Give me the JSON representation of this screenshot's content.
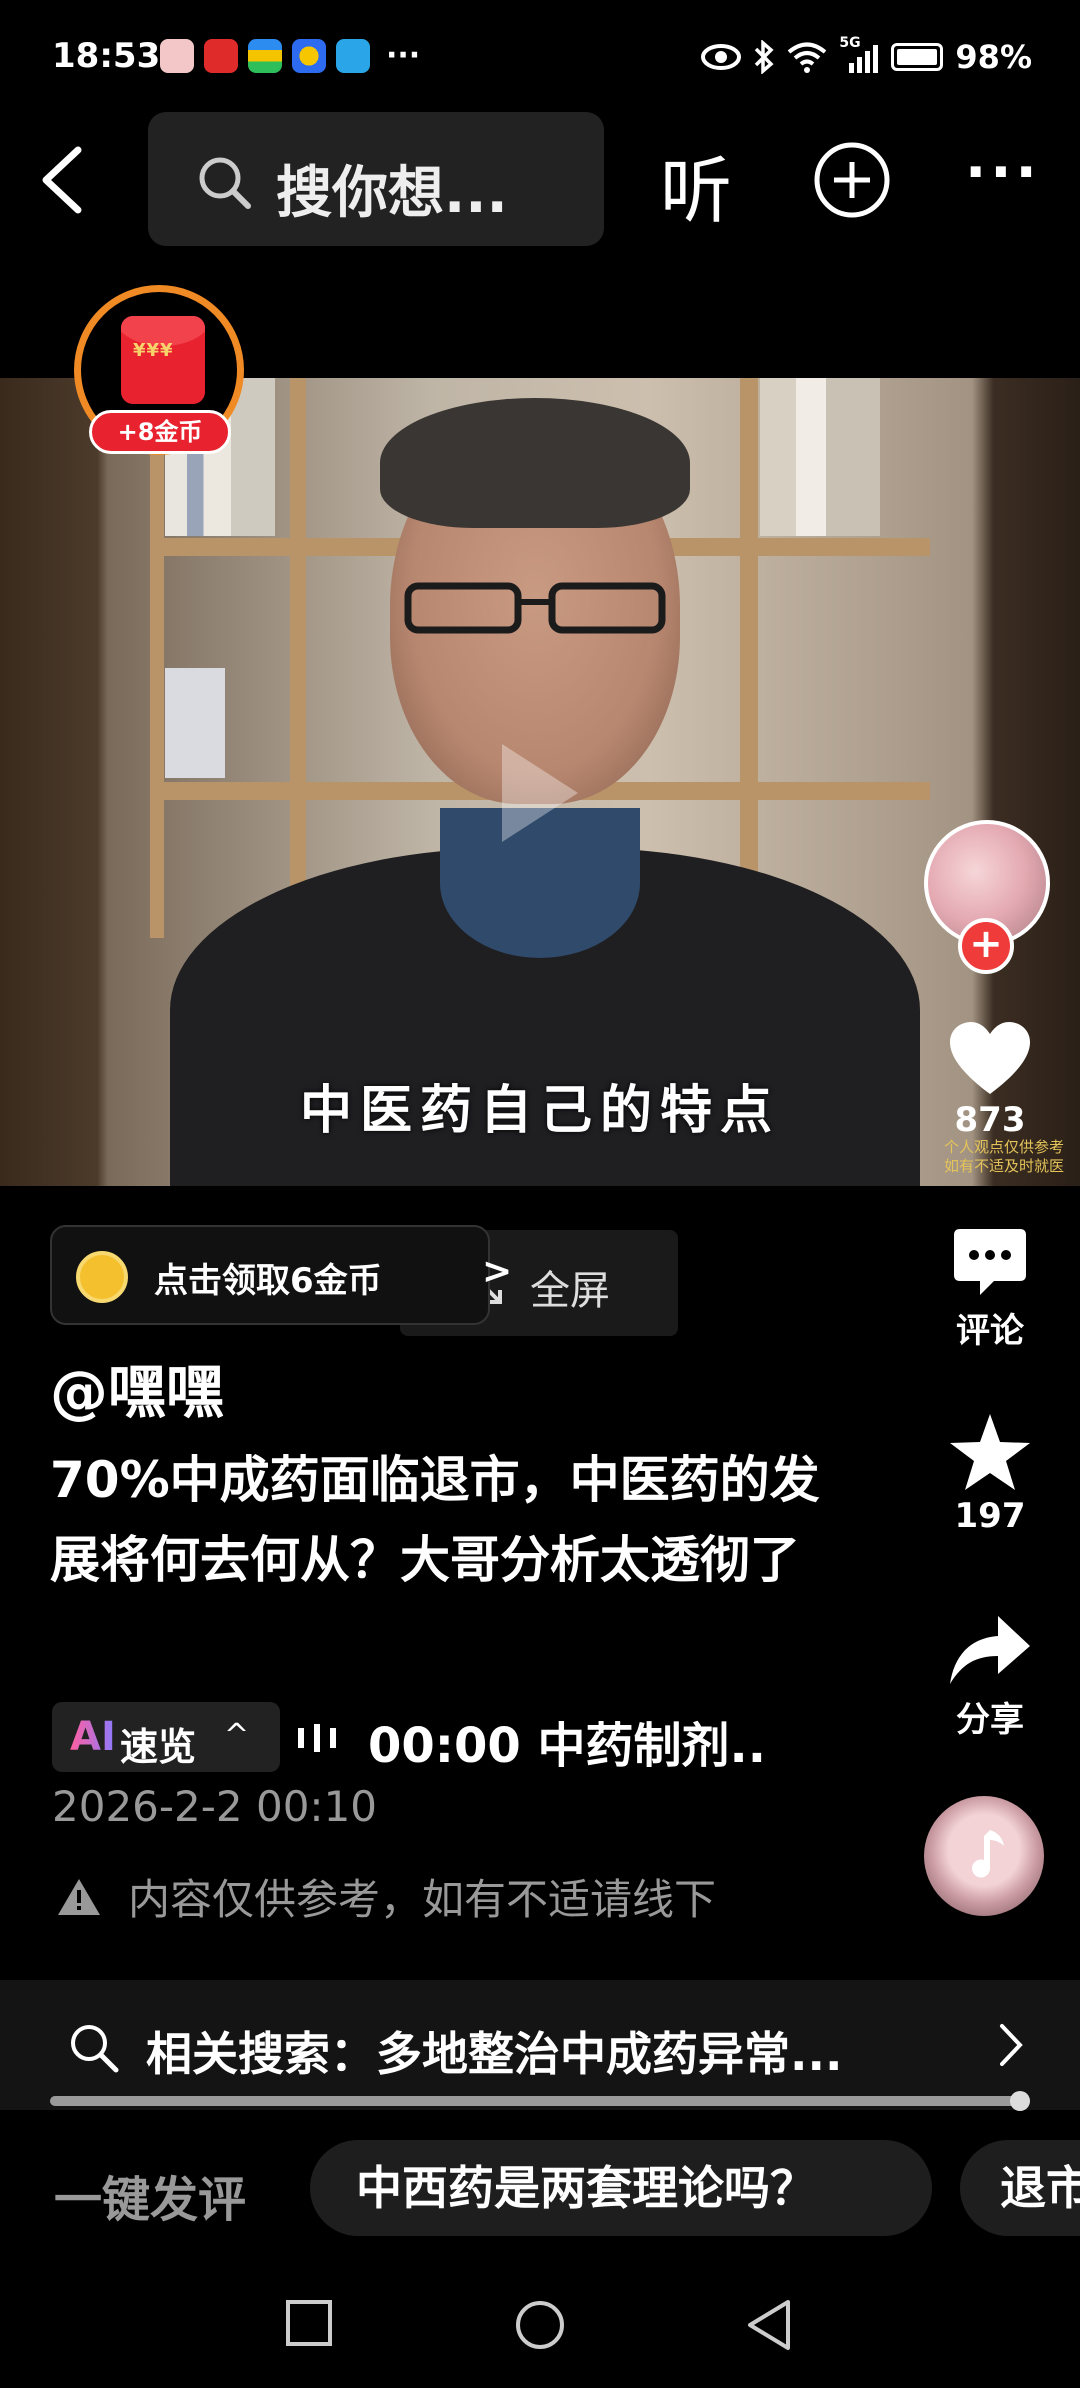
{
  "status_bar": {
    "time": "18:53",
    "more": "···",
    "network": "5G",
    "battery": "98%"
  },
  "top_bar": {
    "search_placeholder": "搜你想...",
    "listen_label": "听",
    "more_label": "···"
  },
  "coin_badge": {
    "label": "+8金币"
  },
  "video": {
    "subtitle": "中医药自己的特点",
    "watermark_line1": "个人观点仅供参考",
    "watermark_line2": "如有不适及时就医"
  },
  "rail": {
    "likes": "873",
    "comment_label": "评论",
    "favorites": "197",
    "share_label": "分享"
  },
  "coin_tip": {
    "text": "点击领取6金币",
    "arrow": ">"
  },
  "fullscreen": {
    "label": "全屏"
  },
  "post": {
    "author": "@嘿嘿",
    "title": "70%中成药面临退市，中医药的发展将何去何从？大哥分析太透彻了",
    "ai_mark": "AI",
    "ai_label": "速览",
    "ai_chevron": "^",
    "audio_info": "00:00 中药制剂..",
    "date": "2026-2-2 00:10",
    "notice": "内容仅供参考，如有不适请线下"
  },
  "related_search": {
    "text": "相关搜索：多地整治中成药异常..."
  },
  "playback": {
    "progress": 0.99
  },
  "quick_comment": {
    "label": "一键发评",
    "chips": [
      "中西药是两套理论吗？",
      "退市"
    ]
  },
  "colors": {
    "accent_red": "#e8232f",
    "badge_ring": "#f08a24",
    "coin_gold": "#f5c02e"
  }
}
